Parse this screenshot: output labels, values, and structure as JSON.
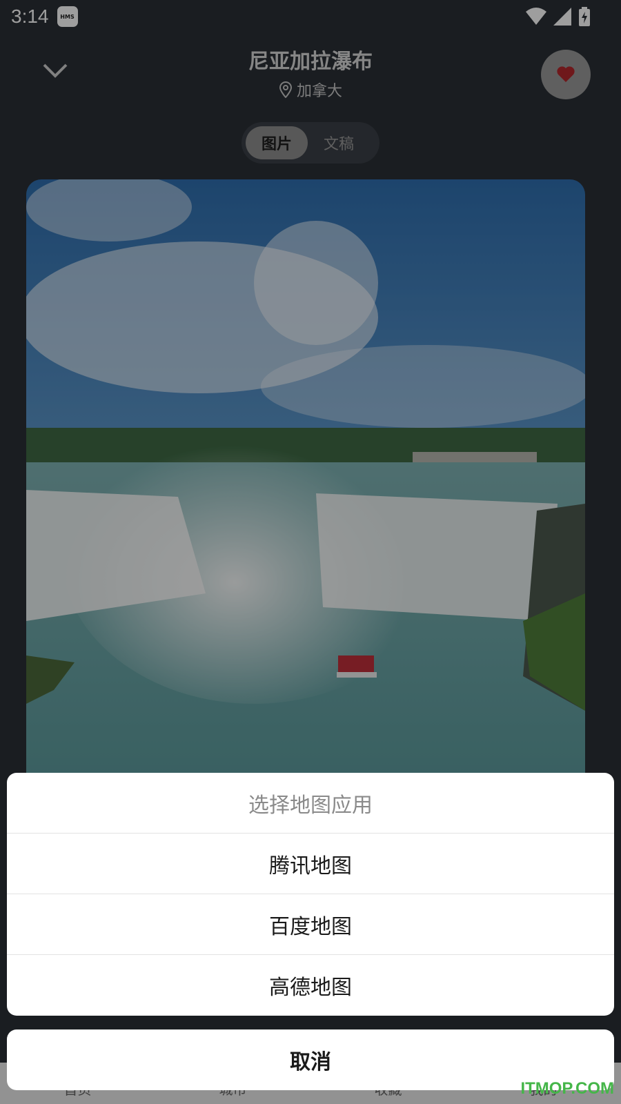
{
  "status_bar": {
    "time": "3:14",
    "badge": "HMS",
    "icons": [
      "wifi-icon",
      "signal-icon",
      "battery-charging-icon"
    ]
  },
  "header": {
    "title": "尼亚加拉瀑布",
    "location": "加拿大",
    "back_icon": "chevron-down-icon",
    "favorite_icon": "heart-icon"
  },
  "tabs": [
    {
      "label": "图片",
      "active": true
    },
    {
      "label": "文稿",
      "active": false
    }
  ],
  "bottom_nav": [
    "首页",
    "城市",
    "收藏",
    "我的"
  ],
  "map_sheet": {
    "title": "选择地图应用",
    "options": [
      "腾讯地图",
      "百度地图",
      "高德地图"
    ],
    "cancel": "取消"
  },
  "watermark": "ITMOP.COM",
  "colors": {
    "background": "#2a2f36",
    "heart": "#b3272d",
    "watermark": "#45b649"
  }
}
